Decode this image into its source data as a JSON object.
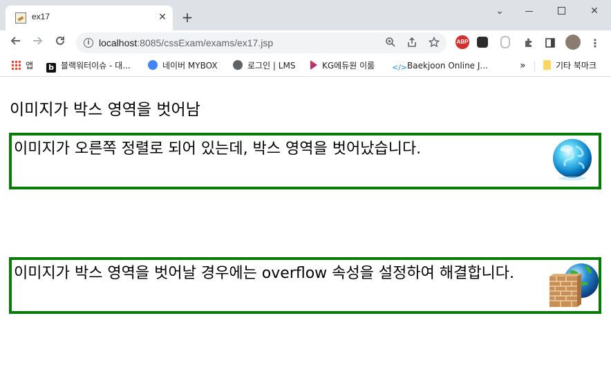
{
  "browser": {
    "tab_title": "ex17",
    "tab_close_glyph": "✕",
    "new_tab_glyph": "+",
    "url_host": "localhost",
    "url_path": ":8085/cssExam/exams/ex17.jsp",
    "window_controls": {
      "menu_glyph": "⌄",
      "close_glyph": "✕"
    }
  },
  "extensions": {
    "abp_label": "ABP"
  },
  "bookmarks": [
    {
      "label": "앱",
      "icon": "apps-grid-icon"
    },
    {
      "label": "블랙워터이슈 - 대...",
      "icon": "b-logo-icon"
    },
    {
      "label": "네이버 MYBOX",
      "icon": "mybox-icon"
    },
    {
      "label": "로그인 | LMS",
      "icon": "globe-icon"
    },
    {
      "label": "KG에듀원 이룸",
      "icon": "kg-icon"
    },
    {
      "label": "Baekjoon Online J...",
      "icon": "code-icon"
    }
  ],
  "bookmarks_overflow": "»",
  "other_bookmarks": "기타 북마크",
  "page": {
    "heading": "이미지가 박스 영역을 벗어남",
    "box1_text": "이미지가 오른쪽 정렬로 되어 있는데, 박스 영역을 벗어났습니다.",
    "box2_text": "이미지가 박스 영역을 벗어날 경우에는 overflow 속성을 설정하여 해결합니다.",
    "border_color": "#087a08"
  }
}
